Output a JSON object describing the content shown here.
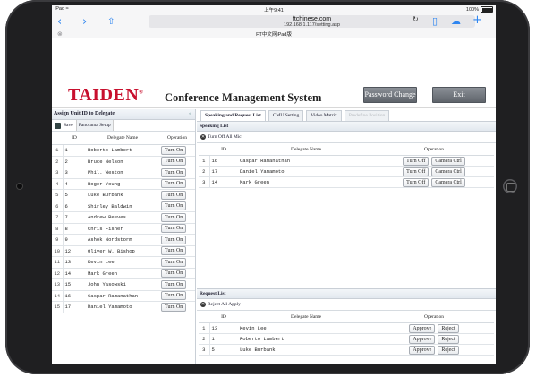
{
  "statusbar": {
    "device": "iPad",
    "wifi": "≈",
    "time": "上午9:41",
    "battery": "100%"
  },
  "browser": {
    "url_host": "ftchinese.com",
    "url_path": "192.168.1.117/setting.asp",
    "page_tab": "FT中文网iPad版",
    "reader_icon": "⊗"
  },
  "header": {
    "logo": "TAIDEN",
    "logo_mark": "®",
    "title": "Conference Management System",
    "password_btn": "Password Change",
    "exit_btn": "Exit"
  },
  "left_panel": {
    "title": "Assign Unit ID to Delegate",
    "collapse_icon": "«",
    "save_label": "Save",
    "panorama_label": "Panorama Setup",
    "columns": [
      "ID",
      "Delegate Name",
      "Operation"
    ],
    "rows": [
      {
        "no": "1",
        "id": "1",
        "name": "Roberto Lambert",
        "op": "Turn On"
      },
      {
        "no": "2",
        "id": "2",
        "name": "Bruce Nelson",
        "op": "Turn On"
      },
      {
        "no": "3",
        "id": "3",
        "name": "Phil. Weston",
        "op": "Turn On"
      },
      {
        "no": "4",
        "id": "4",
        "name": "Roger Young",
        "op": "Turn On"
      },
      {
        "no": "5",
        "id": "5",
        "name": "Luke Burbank",
        "op": "Turn On"
      },
      {
        "no": "6",
        "id": "6",
        "name": "Shirley Baldwin",
        "op": "Turn On"
      },
      {
        "no": "7",
        "id": "7",
        "name": "Andrew Reeves",
        "op": "Turn On"
      },
      {
        "no": "8",
        "id": "8",
        "name": "Chris Fisher",
        "op": "Turn On"
      },
      {
        "no": "9",
        "id": "9",
        "name": "Ashok Nordstorm",
        "op": "Turn On"
      },
      {
        "no": "10",
        "id": "12",
        "name": "Oliver W. Bishop",
        "op": "Turn On"
      },
      {
        "no": "11",
        "id": "13",
        "name": "Kevin Lee",
        "op": "Turn On"
      },
      {
        "no": "12",
        "id": "14",
        "name": "Mark Green",
        "op": "Turn On"
      },
      {
        "no": "13",
        "id": "15",
        "name": "John Yasowski",
        "op": "Turn On"
      },
      {
        "no": "14",
        "id": "16",
        "name": "Caspar Ramanathan",
        "op": "Turn On"
      },
      {
        "no": "15",
        "id": "17",
        "name": "Daniel Yamamoto",
        "op": "Turn On"
      }
    ]
  },
  "tabs": [
    {
      "label": "Speaking and Request List",
      "state": "active"
    },
    {
      "label": "CMU Setting",
      "state": "normal"
    },
    {
      "label": "Video Matrix",
      "state": "normal"
    },
    {
      "label": "Predefine Position",
      "state": "disabled"
    }
  ],
  "speaking": {
    "title": "Speaking List",
    "turn_off_all": "Turn Off All Mic.",
    "columns": [
      "ID",
      "Delegate Name",
      "Operation"
    ],
    "rows": [
      {
        "no": "1",
        "id": "16",
        "name": "Caspar Ramanathan",
        "btn1": "Turn Off",
        "btn2": "Camera Ctrl"
      },
      {
        "no": "2",
        "id": "17",
        "name": "Daniel Yamamoto",
        "btn1": "Turn Off",
        "btn2": "Camera Ctrl"
      },
      {
        "no": "3",
        "id": "14",
        "name": "Mark Green",
        "btn1": "Turn Off",
        "btn2": "Camera Ctrl"
      }
    ]
  },
  "request": {
    "title": "Request List",
    "reject_all": "Reject All Apply",
    "columns": [
      "ID",
      "Delegate Name",
      "Operation"
    ],
    "rows": [
      {
        "no": "1",
        "id": "13",
        "name": "Kevin Lee",
        "btn1": "Approve",
        "btn2": "Reject"
      },
      {
        "no": "2",
        "id": "1",
        "name": "Roberto Lambert",
        "btn1": "Approve",
        "btn2": "Reject"
      },
      {
        "no": "3",
        "id": "5",
        "name": "Luke Burbank",
        "btn1": "Approve",
        "btn2": "Reject"
      }
    ]
  },
  "colors": {
    "brand": "#c8102e",
    "accent": "#2f86f0",
    "button": "#6b7078"
  }
}
